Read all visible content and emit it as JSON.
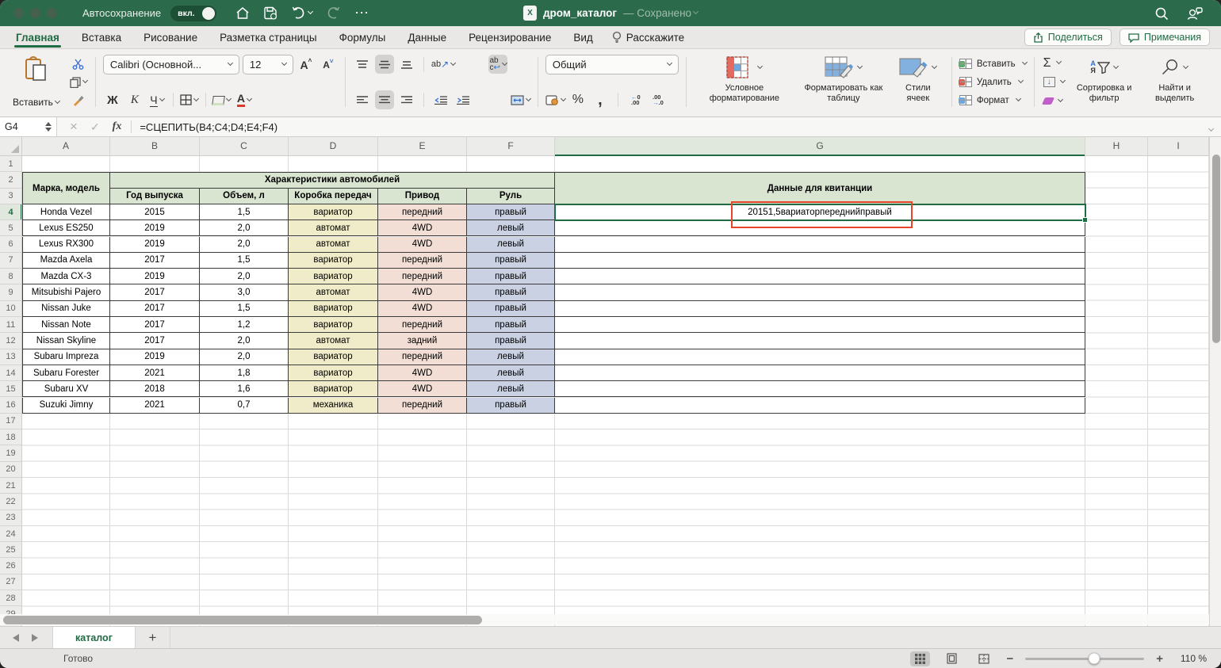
{
  "titlebar": {
    "autosave_label": "Автосохранение",
    "autosave_state": "вкл.",
    "doc_title": "дром_каталог",
    "doc_status": "— Сохранено"
  },
  "tabs": {
    "items": [
      "Главная",
      "Вставка",
      "Рисование",
      "Разметка страницы",
      "Формулы",
      "Данные",
      "Рецензирование",
      "Вид"
    ],
    "active": "Главная",
    "tell_me": "Расскажите",
    "share_label": "Поделиться",
    "comments_label": "Примечания"
  },
  "ribbon": {
    "paste_label": "Вставить",
    "font_name": "Calibri (Основной...",
    "font_size": "12",
    "bold_label": "Ж",
    "italic_label": "К",
    "underline_label": "Ч",
    "orientation_label": "ab",
    "wrap_label": "ab",
    "number_format": "Общий",
    "percent_glyph": "%",
    "comma_glyph": ",",
    "autosum_glyph": "Σ",
    "conditional_formatting": "Условное форматирование",
    "format_as_table": "Форматировать как таблицу",
    "cell_styles": "Стили ячеек",
    "cells_insert": "Вставить",
    "cells_delete": "Удалить",
    "cells_format": "Формат",
    "sort_filter": "Сортировка и фильтр",
    "find_select": "Найти и выделить"
  },
  "formula_bar": {
    "name_box": "G4",
    "fx_glyph": "fx",
    "formula": "=СЦЕПИТЬ(B4;C4;D4;E4;F4)"
  },
  "sheet": {
    "columns": [
      "A",
      "B",
      "C",
      "D",
      "E",
      "F",
      "G",
      "H",
      "I"
    ],
    "selected_column": "G",
    "selected_row": "4",
    "row_count": 29,
    "table": {
      "corner_header": "Марка, модель",
      "group_header": "Характеристики автомобилей",
      "receipt_header": "Данные для квитанции",
      "col_headers": [
        "Год выпуска",
        "Объем, л",
        "Коробка передач",
        "Привод",
        "Руль"
      ],
      "rows": [
        [
          "Honda Vezel",
          "2015",
          "1,5",
          "вариатор",
          "передний",
          "правый"
        ],
        [
          "Lexus ES250",
          "2019",
          "2,0",
          "автомат",
          "4WD",
          "левый"
        ],
        [
          "Lexus RX300",
          "2019",
          "2,0",
          "автомат",
          "4WD",
          "левый"
        ],
        [
          "Mazda Axela",
          "2017",
          "1,5",
          "вариатор",
          "передний",
          "правый"
        ],
        [
          "Mazda CX-3",
          "2019",
          "2,0",
          "вариатор",
          "передний",
          "правый"
        ],
        [
          "Mitsubishi Pajero",
          "2017",
          "3,0",
          "автомат",
          "4WD",
          "правый"
        ],
        [
          "Nissan Juke",
          "2017",
          "1,5",
          "вариатор",
          "4WD",
          "правый"
        ],
        [
          "Nissan Note",
          "2017",
          "1,2",
          "вариатор",
          "передний",
          "правый"
        ],
        [
          "Nissan Skyline",
          "2017",
          "2,0",
          "автомат",
          "задний",
          "правый"
        ],
        [
          "Subaru Impreza",
          "2019",
          "2,0",
          "вариатор",
          "передний",
          "левый"
        ],
        [
          "Subaru Forester",
          "2021",
          "1,8",
          "вариатор",
          "4WD",
          "левый"
        ],
        [
          "Subaru XV",
          "2018",
          "1,6",
          "вариатор",
          "4WD",
          "левый"
        ],
        [
          "Suzuki Jimny",
          "2021",
          "0,7",
          "механика",
          "передний",
          "правый"
        ]
      ],
      "active_cell_value": "20151,5вариаторпереднийправый"
    }
  },
  "sheetbar": {
    "tab_name": "каталог",
    "add_label": "+"
  },
  "statusbar": {
    "mode": "Готово",
    "zoom_level": "110 %"
  },
  "colors": {
    "title_green": "#2b6a4b",
    "accent_green": "#1f6b43",
    "table_header_fill": "#d9e5d1",
    "gearbox_fill": "#f0ebc8",
    "drive_fill": "#f2ded4",
    "wheel_fill": "#c9d1e3",
    "annotation_red": "#e8442a"
  }
}
